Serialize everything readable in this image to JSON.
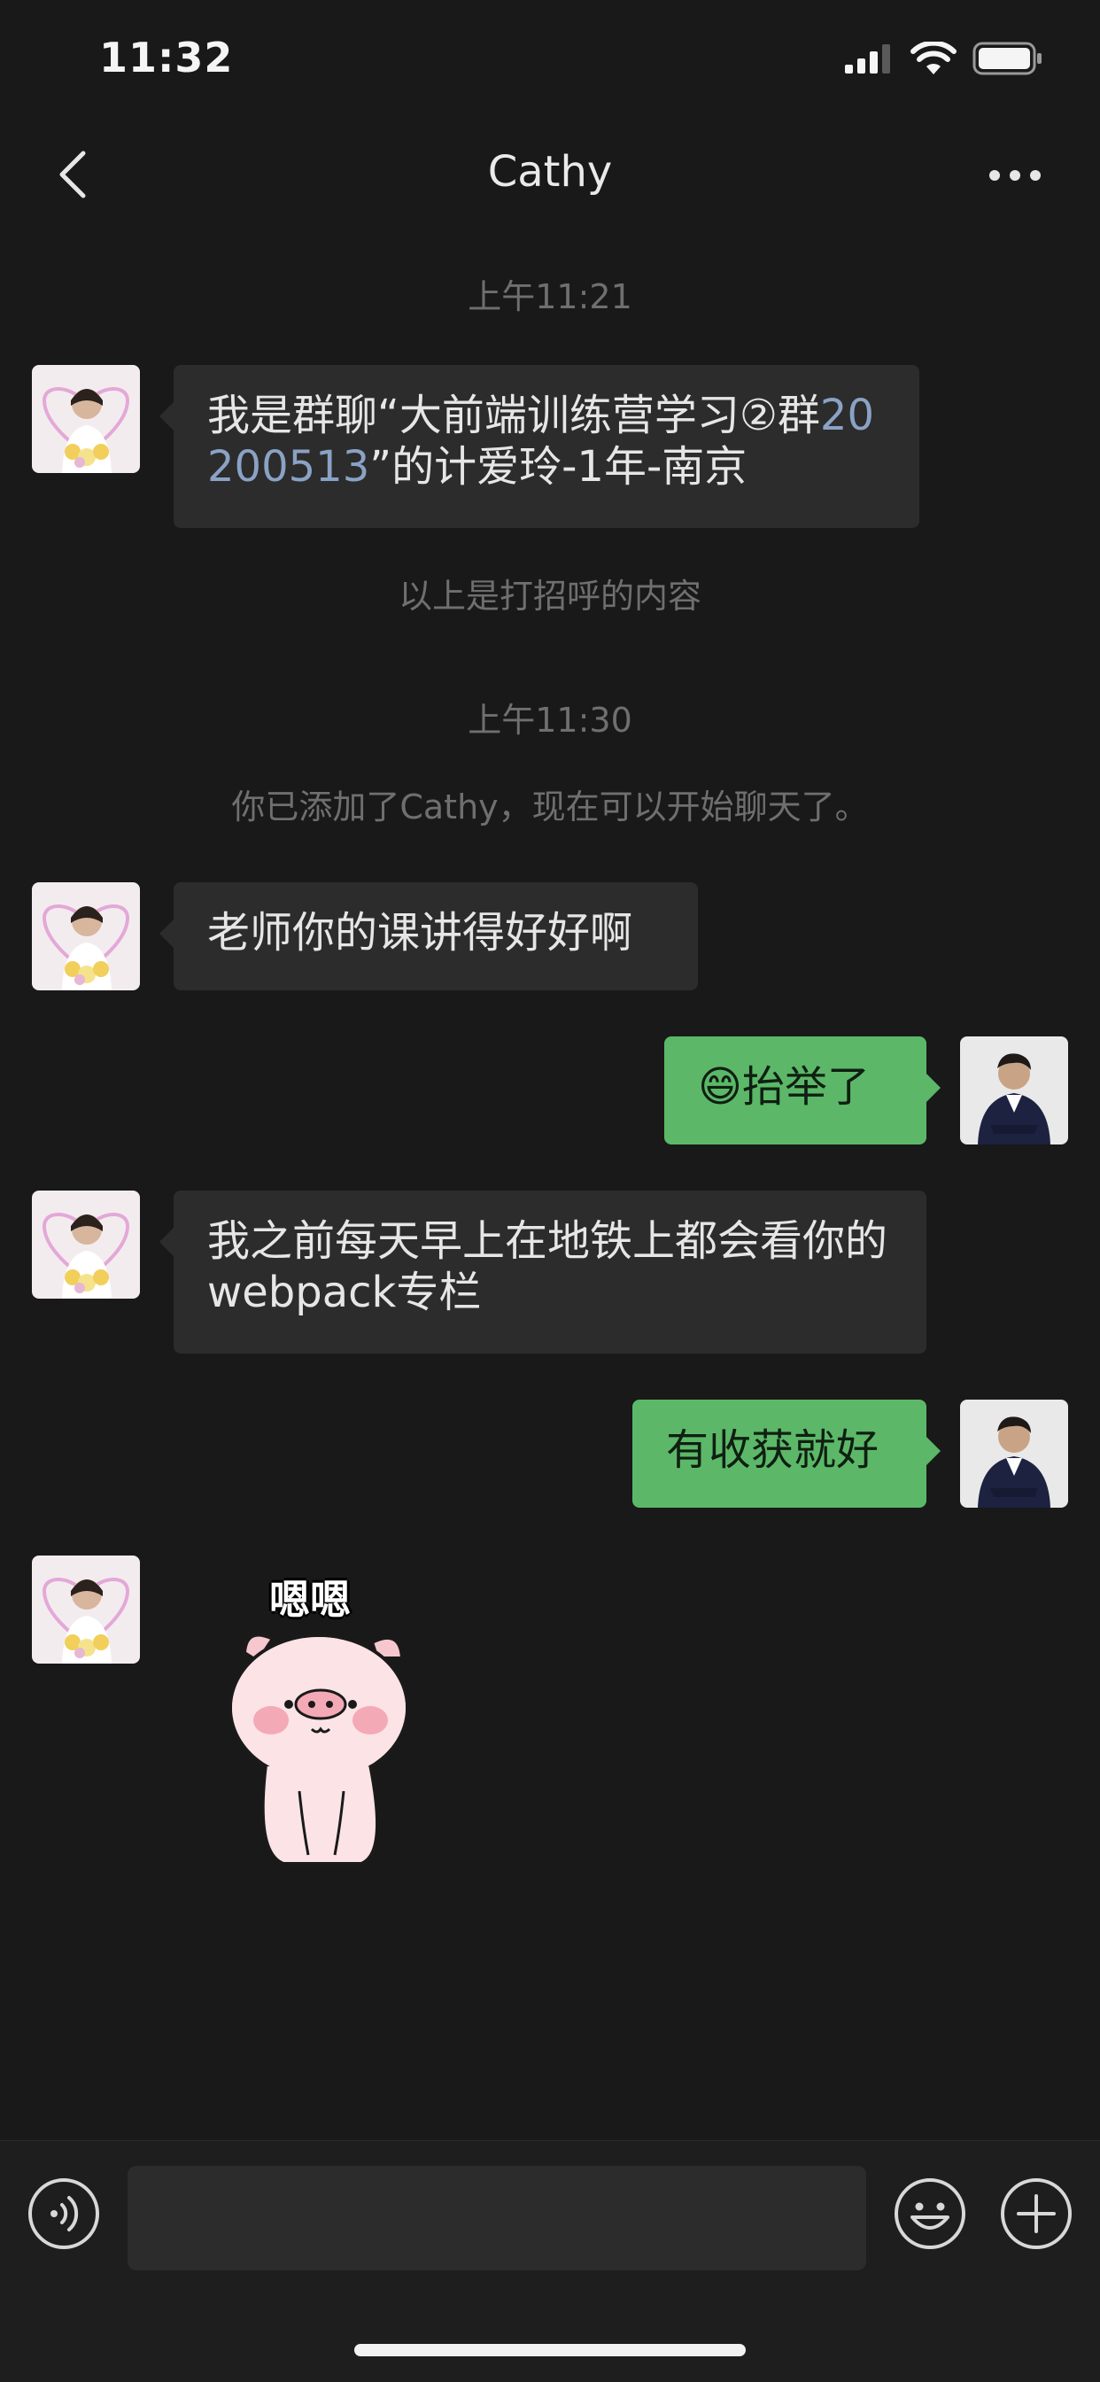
{
  "status_bar": {
    "time": "11:32"
  },
  "nav": {
    "title": "Cathy"
  },
  "messages": {
    "ts1": "上午11:21",
    "msg1_part1": "我是群聊“大前端训练营学习②群",
    "msg1_link": "20200513",
    "msg1_part2": "”的计爱玲-1年-南京",
    "greeting_note": "以上是打招呼的内容",
    "ts2": "上午11:30",
    "added_note": "你已添加了Cathy，现在可以开始聊天了。",
    "msg2": "老师你的课讲得好好啊",
    "msg3_emoji": "😄",
    "msg3": "抬举了",
    "msg4": "我之前每天早上在地铁上都会看你的webpack专栏",
    "msg5": "有收获就好",
    "sticker_text": "嗯嗯"
  },
  "input": {
    "placeholder": ""
  },
  "icons": {
    "back": "chevron-left-icon",
    "more": "more-icon",
    "voice": "voice-icon",
    "emoji": "emoji-icon",
    "plus": "plus-icon"
  },
  "colors": {
    "background": "#191919",
    "bubble_left": "#2c2c2c",
    "bubble_right": "#5cb868",
    "link": "#8aa2c4"
  }
}
